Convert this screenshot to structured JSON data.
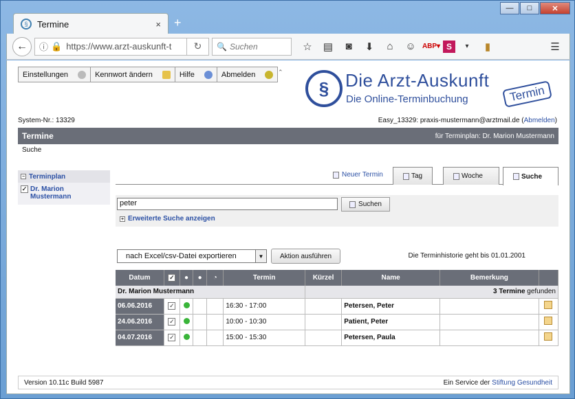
{
  "browser": {
    "tab_title": "Termine",
    "url": "https://www.arzt-auskunft-t",
    "search_placeholder": "Suchen",
    "new_tab": "+",
    "close_tab": "×"
  },
  "menu": {
    "items": [
      "Einstellungen",
      "Kennwort ändern",
      "Hilfe",
      "Abmelden"
    ]
  },
  "logo": {
    "title": "Die Arzt-Auskunft",
    "subtitle": "Die Online-Terminbuchung",
    "stamp": "Termin"
  },
  "system": {
    "nr_label": "System-Nr.: 13329",
    "account": "Easy_13329: praxis-mustermann@arztmail.de (",
    "logout": "Abmelden",
    "account_end": ")"
  },
  "bar": {
    "title": "Termine",
    "plan": "für Terminplan: Dr. Marion Mustermann"
  },
  "breadcrumb": "Suche",
  "sidebar": {
    "header": "Terminplan",
    "item": "Dr. Marion Mustermann"
  },
  "tabs": {
    "new": "Neuer Termin",
    "day": "Tag",
    "week": "Woche",
    "search": "Suche"
  },
  "search": {
    "value": "peter",
    "button": "Suchen",
    "extended": "Erweiterte Suche anzeigen"
  },
  "actions": {
    "select": "nach Excel/csv-Datei exportieren",
    "button": "Aktion ausführen",
    "history": "Die Terminhistorie geht bis 01.01.2001"
  },
  "table": {
    "headers": [
      "Datum",
      "Termin",
      "Kürzel",
      "Name",
      "Bemerkung"
    ],
    "group": "Dr. Marion Mustermann",
    "count_bold": "3 Termine",
    "count_rest": " gefunden",
    "rows": [
      {
        "date": "06.06.2016",
        "time": "16:30 - 17:00",
        "name": "Petersen, Peter"
      },
      {
        "date": "24.06.2016",
        "time": "10:00 - 10:30",
        "name": "Patient, Peter"
      },
      {
        "date": "04.07.2016",
        "time": "15:00 - 15:30",
        "name": "Petersen, Paula"
      }
    ]
  },
  "footer": {
    "version": "Version 10.11c Build 5987",
    "service": "Ein Service der ",
    "org": "Stiftung Gesundheit"
  }
}
